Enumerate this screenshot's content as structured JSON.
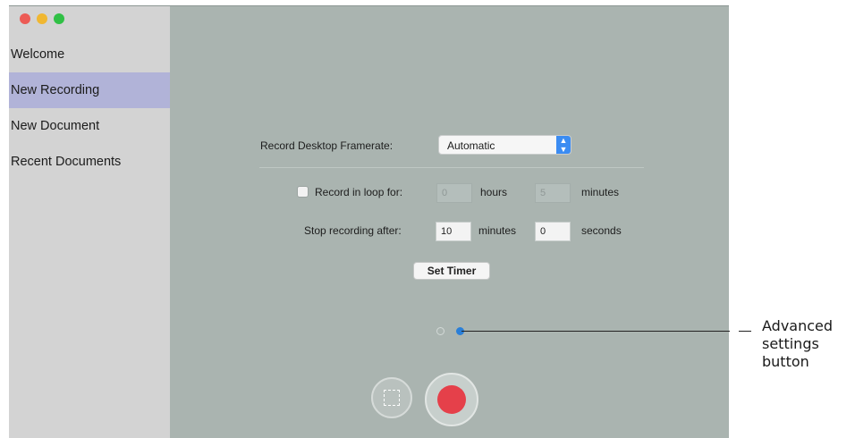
{
  "sidebar": {
    "items": [
      {
        "label": "Welcome"
      },
      {
        "label": "New Recording",
        "selected": true
      },
      {
        "label": "New Document"
      },
      {
        "label": "Recent Documents"
      }
    ]
  },
  "framerate": {
    "label": "Record Desktop Framerate:",
    "value": "Automatic"
  },
  "loop": {
    "label": "Record in loop for:",
    "checked": false,
    "hours_value": "0",
    "hours_label": "hours",
    "minutes_value": "5",
    "minutes_label": "minutes"
  },
  "stop": {
    "label": "Stop recording after:",
    "minutes_value": "10",
    "minutes_label": "minutes",
    "seconds_value": "0",
    "seconds_label": "seconds"
  },
  "set_timer_label": "Set Timer",
  "pager": {
    "count": 2,
    "active_index": 1
  },
  "annotation": {
    "line1": "Advanced",
    "line2": "settings",
    "line3": "button"
  },
  "colors": {
    "accent": "#2a7fd8",
    "record": "#e5404a",
    "sidebar_selected": "#b1b3d8"
  },
  "icons": [
    "close-icon",
    "minimize-icon",
    "zoom-icon",
    "popup-arrows-icon",
    "area-select-icon",
    "record-icon"
  ]
}
